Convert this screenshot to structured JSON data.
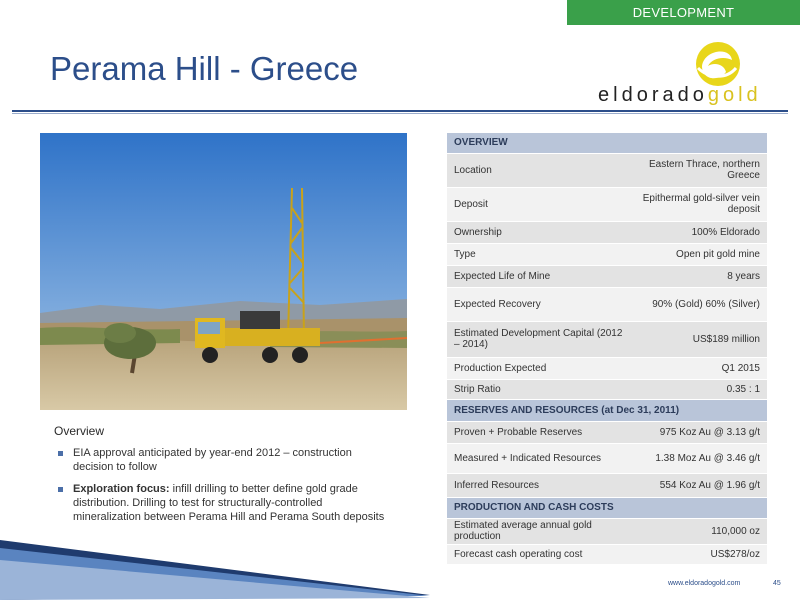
{
  "header": {
    "tag": "DEVELOPMENT",
    "title": "Perama Hill - Greece"
  },
  "logo": {
    "text_dark": "eldorado",
    "text_light": "gold"
  },
  "photo": {
    "subject": "drill-rig-on-hillside"
  },
  "overview": {
    "heading": "Overview",
    "bullets": [
      {
        "lead": "",
        "text": "EIA approval anticipated by year-end 2012 – construction decision to follow"
      },
      {
        "lead": "Exploration focus:",
        "text": " infill drilling to better define gold grade distribution.  Drilling to test for structurally-controlled mineralization between Perama Hill and Perama South deposits"
      }
    ]
  },
  "table": {
    "overview_header": "OVERVIEW",
    "overview_rows": [
      {
        "label": "Location",
        "value": "Eastern Thrace, northern Greece"
      },
      {
        "label": "Deposit",
        "value": "Epithermal gold-silver vein deposit"
      },
      {
        "label": "Ownership",
        "value": "100% Eldorado"
      },
      {
        "label": "Type",
        "value": "Open pit gold mine"
      },
      {
        "label": "Expected Life of Mine",
        "value": "8 years"
      },
      {
        "label": "Expected Recovery",
        "value": "90% (Gold) 60% (Silver)"
      },
      {
        "label": "Estimated Development Capital (2012 – 2014)",
        "value": "US$189 million"
      },
      {
        "label": "Production Expected",
        "value": "Q1 2015"
      },
      {
        "label": "Strip Ratio",
        "value": "0.35 : 1"
      }
    ],
    "reserves_header": "RESERVES AND RESOURCES (at Dec 31, 2011)",
    "reserves_rows": [
      {
        "label": "Proven + Probable Reserves",
        "value": "975 Koz Au @ 3.13 g/t"
      },
      {
        "label": "Measured + Indicated Resources",
        "value": "1.38 Moz Au @ 3.46 g/t"
      },
      {
        "label": "Inferred Resources",
        "value": "554 Koz Au @ 1.96 g/t"
      }
    ],
    "production_header": "PRODUCTION AND CASH COSTS",
    "production_rows": [
      {
        "label": "Estimated average annual gold production",
        "value": "110,000 oz"
      },
      {
        "label": "Forecast cash operating cost",
        "value": "US$278/oz"
      }
    ]
  },
  "footer": {
    "url": "www.eldoradogold.com",
    "page": "45"
  },
  "colors": {
    "accent_green": "#3aa04a",
    "title_blue": "#2c4e8a",
    "section_blue": "#b9c5d9",
    "logo_yellow": "#d9c21f"
  }
}
